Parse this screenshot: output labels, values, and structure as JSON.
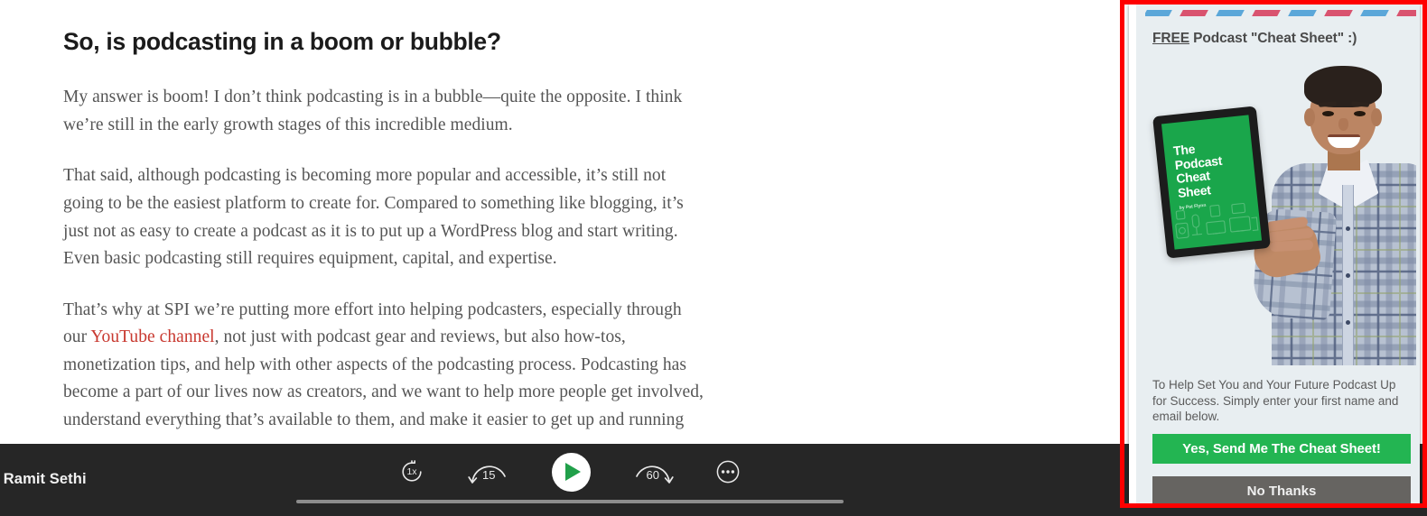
{
  "article": {
    "heading": "So, is podcasting in a boom or bubble?",
    "paragraph_1": "My answer is boom! I don’t think podcasting is in a bubble—quite the opposite. I think we’re still in the early growth stages of this incredible medium.",
    "paragraph_2": "That said, although podcasting is becoming more popular and accessible, it’s still not going to be the easiest platform to create for. Compared to something like blogging, it’s just not as easy to create a podcast as it is to put up a WordPress blog and start writing. Even basic podcasting still requires equipment, capital, and expertise.",
    "paragraph_3_before": "That’s why at SPI we’re putting more effort into helping podcasters, especially through our ",
    "paragraph_3_link": "YouTube channel",
    "paragraph_3_after": ", not just with podcast gear and reviews, but also how-tos, monetization tips, and help with other aspects of the podcasting process. Podcasting has become a part of our lives now as creators, and we want to help more people get involved, understand everything that’s available to them, and make it easier to get up and running",
    "link_color": "#c8382f"
  },
  "player": {
    "episode_title": "ealth with Ramit Sethi",
    "speed_label": "1x",
    "rewind_label": "15",
    "forward_label": "60",
    "play_icon": "play-icon",
    "speed_icon": "playback-speed-icon",
    "rewind_icon": "rewind-15-icon",
    "forward_icon": "forward-60-icon",
    "more_icon": "more-options-icon",
    "background_color": "#262626",
    "accent_color": "#21a04a",
    "progress_percent": 0
  },
  "popup": {
    "heading_emphasis": "FREE",
    "heading_rest": " Podcast \"Cheat Sheet\" :)",
    "stripe_colors": [
      "#5ba7d9",
      "#d9536f",
      "#5ba7d9",
      "#d9536f",
      "#5ba7d9",
      "#d9536f",
      "#5ba7d9",
      "#d9536f",
      "#5ba7d9"
    ],
    "ebook": {
      "title_line_1": "The",
      "title_line_2": "Podcast",
      "title_line_3": "Cheat",
      "title_line_4": "Sheet",
      "byline": "by Pat Flynn",
      "cover_color": "#1aa64b"
    },
    "body_copy": "To Help Set You and Your Future Podcast Up for Success. Simply enter your first name and email below.",
    "primary_button": "Yes, Send Me The Cheat Sheet!",
    "secondary_button": "No Thanks",
    "primary_button_color": "#23b552",
    "secondary_button_color": "#666461",
    "highlight_border_color": "#fe0000",
    "background_color": "#e8eef1"
  }
}
